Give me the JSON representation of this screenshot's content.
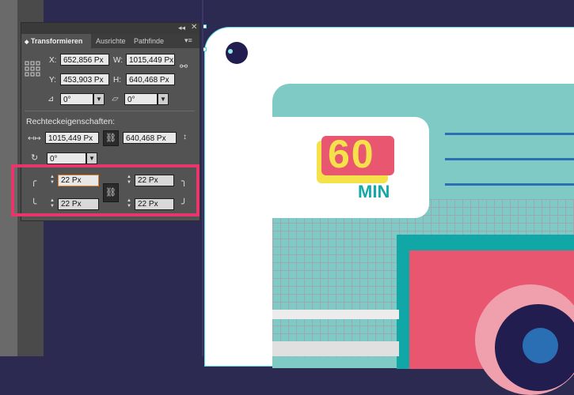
{
  "panel": {
    "collapse_icon": "double-chevron-icon",
    "close_label": "✕",
    "tabs": [
      "Transformieren",
      "Ausrichte",
      "Pathfinde"
    ],
    "transform": {
      "x_label": "X:",
      "x_value": "652,856 Px",
      "y_label": "Y:",
      "y_value": "453,903 Px",
      "w_label": "W:",
      "w_value": "1015,449 Px",
      "h_label": "H:",
      "h_value": "640,468 Px",
      "angle_value": "0°",
      "shear_value": "0°"
    },
    "rect_props": {
      "title": "Rechteckeigenschaften:",
      "width_value": "1015,449 Px",
      "height_value": "640,468 Px",
      "rotation_value": "0°"
    },
    "corners": {
      "top_left": "22 Px",
      "top_right": "22 Px",
      "bottom_left": "22 Px",
      "bottom_right": "22 Px"
    }
  },
  "artwork": {
    "badge_number": "60",
    "badge_unit": "MIN"
  },
  "colors": {
    "highlight": "#e8356b",
    "canvas_bg": "#2d2a52",
    "teal": "#7fcac5",
    "pink": "#e8566f"
  }
}
